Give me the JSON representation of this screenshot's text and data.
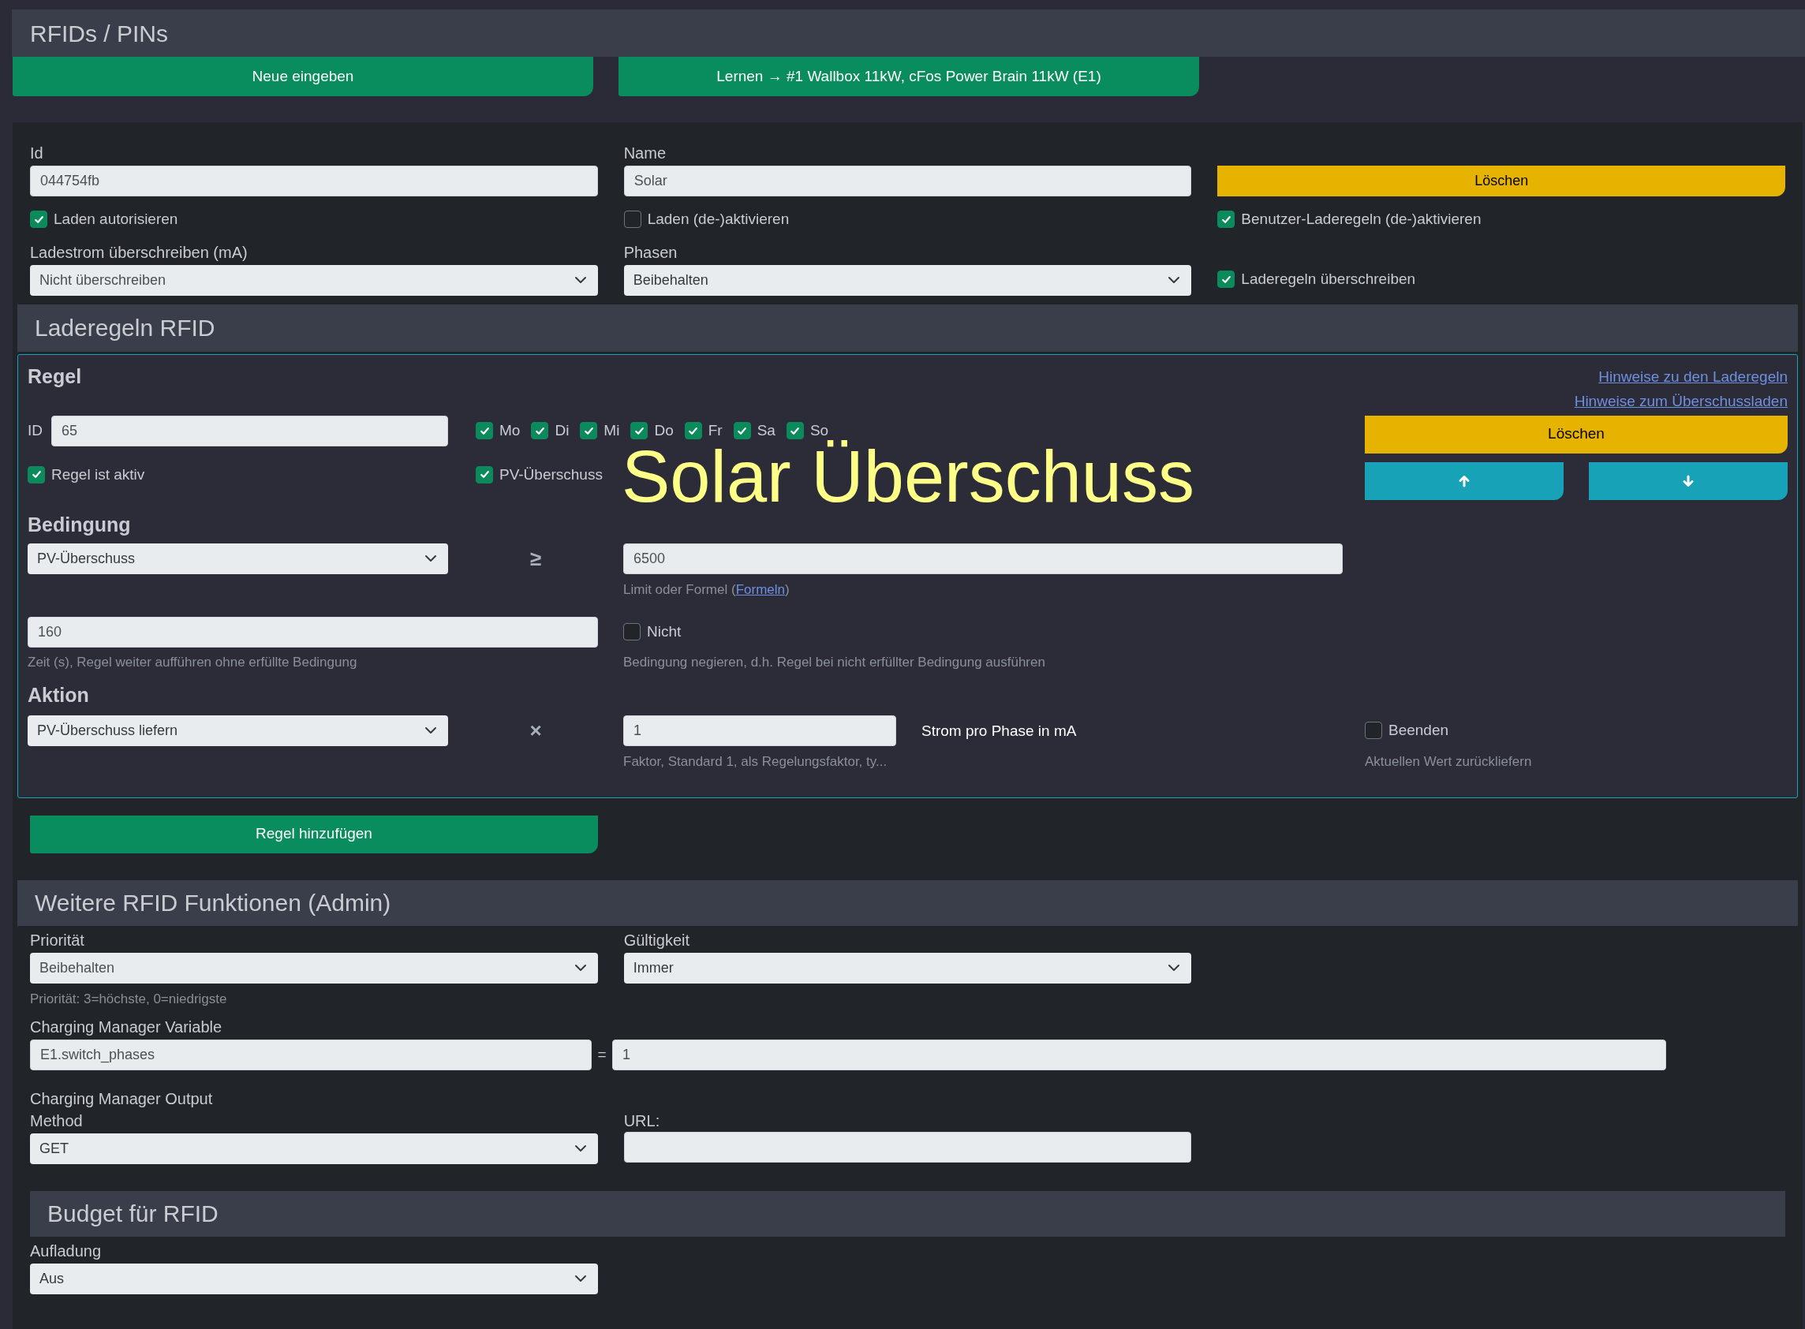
{
  "page_title": "RFIDs / PINs",
  "top_buttons": [
    "Neue eingeben",
    "Lernen → #1 Wallbox 11kW, cFos Power Brain 11kW (E1)"
  ],
  "rfid": {
    "id": {
      "label": "Id",
      "value": "044754fb"
    },
    "name": {
      "label": "Name",
      "value": "Solar"
    },
    "delete_button": "Löschen",
    "checkboxes": [
      {
        "label": "Laden autorisieren",
        "checked": true
      },
      {
        "label": "Laden (de-)aktivieren",
        "checked": false
      },
      {
        "label": "Benutzer-Laderegeln (de-)aktivieren",
        "checked": true
      }
    ],
    "charge_current": {
      "label": "Ladestrom überschreiben (mA)",
      "value": "Nicht überschreiben"
    },
    "phases": {
      "label": "Phasen",
      "value": "Beibehalten"
    },
    "override_rules": {
      "label": "Laderegeln überschreiben",
      "checked": true
    }
  },
  "charging_rules": {
    "title": "Laderegeln RFID",
    "rule": {
      "heading": "Regel",
      "links": [
        "Hinweise zu den Laderegeln",
        "Hinweise zum Überschussladen"
      ],
      "id_label": "ID",
      "id_value": "65",
      "days": [
        {
          "label": "Mo",
          "checked": true
        },
        {
          "label": "Di",
          "checked": true
        },
        {
          "label": "Mi",
          "checked": true
        },
        {
          "label": "Do",
          "checked": true
        },
        {
          "label": "Fr",
          "checked": true
        },
        {
          "label": "Sa",
          "checked": true
        },
        {
          "label": "So",
          "checked": true
        }
      ],
      "delete_button": "Löschen",
      "active": {
        "label": "Regel ist aktiv",
        "checked": true
      },
      "pv_surplus": {
        "label": "PV-Überschuss",
        "checked": true
      },
      "comment": "Solar Überschuss",
      "condition": {
        "heading": "Bedingung",
        "value": "PV-Überschuss",
        "operator": "≥",
        "limit": "6500",
        "limit_hint": {
          "before": "Limit oder Formel (",
          "link": "Formeln",
          "after": ")"
        },
        "time": "160",
        "time_hint": "Zeit (s), Regel weiter aufführen ohne erfüllte Bedingung",
        "negate": {
          "label": "Nicht",
          "checked": false
        },
        "negate_hint": "Bedingung negieren, d.h. Regel bei nicht erfüllter Bedingung ausführen"
      },
      "action": {
        "heading": "Aktion",
        "value": "PV-Überschuss liefern",
        "operator": "×",
        "factor": "1",
        "factor_hint": "Faktor, Standard 1, als Regelungsfaktor, ty...",
        "unit": "Strom pro Phase in mA",
        "end": {
          "label": "Beenden",
          "checked": false
        },
        "end_hint": "Aktuellen Wert zurückliefern"
      }
    },
    "add_button": "Regel hinzufügen"
  },
  "admin": {
    "title": "Weitere RFID Funktionen (Admin)",
    "priority": {
      "label": "Priorität",
      "value": "Beibehalten",
      "hint": "Priorität: 3=höchste, 0=niedrigste"
    },
    "validity": {
      "label": "Gültigkeit",
      "value": "Immer"
    },
    "variable": {
      "label": "Charging Manager Variable",
      "name": "E1.switch_phases",
      "operator": "=",
      "value": "1"
    },
    "output": {
      "label": "Charging Manager Output",
      "method_label": "Method",
      "method": "GET",
      "url_label": "URL:"
    }
  },
  "budget": {
    "title": "Budget für RFID",
    "label": "Aufladung",
    "value": "Aus"
  }
}
